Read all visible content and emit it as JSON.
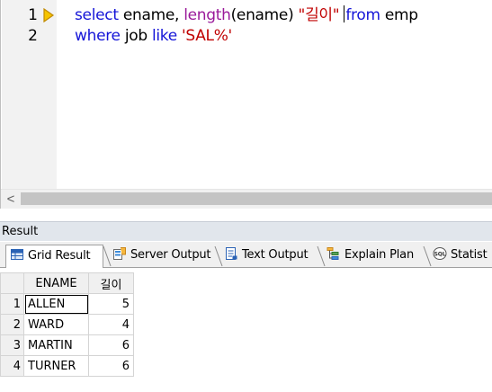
{
  "editor": {
    "line_numbers": [
      "1",
      "2"
    ],
    "line1": {
      "kw_select": "select",
      "t1": " ename, ",
      "fn_length": "length",
      "t2": "(ename) ",
      "str_alias": "\"길이\"",
      "t3": " ",
      "kw_from": "from",
      "t4": " emp"
    },
    "line2": {
      "kw_where": "where",
      "t1": " job ",
      "kw_like": "like",
      "t2": " ",
      "str_pattern": "'SAL%'"
    },
    "scroll_left_glyph": "<"
  },
  "result": {
    "title": "Result",
    "tabs": [
      {
        "label": "Grid Result",
        "icon": "grid-icon"
      },
      {
        "label": "Server Output",
        "icon": "server-output-icon"
      },
      {
        "label": "Text Output",
        "icon": "text-output-icon"
      },
      {
        "label": "Explain Plan",
        "icon": "explain-plan-icon"
      },
      {
        "label": "Statist",
        "icon": "sql-statistics-icon"
      }
    ],
    "grid": {
      "columns": [
        "ENAME",
        "길이"
      ],
      "rows": [
        {
          "num": "1",
          "ename": "ALLEN",
          "len": "5"
        },
        {
          "num": "2",
          "ename": "WARD",
          "len": "4"
        },
        {
          "num": "3",
          "ename": "MARTIN",
          "len": "6"
        },
        {
          "num": "4",
          "ename": "TURNER",
          "len": "6"
        }
      ]
    }
  },
  "colors": {
    "keyword": "#1515d8",
    "function": "#9a1a9a",
    "string": "#c00000",
    "execution_arrow": "#f5c400"
  }
}
